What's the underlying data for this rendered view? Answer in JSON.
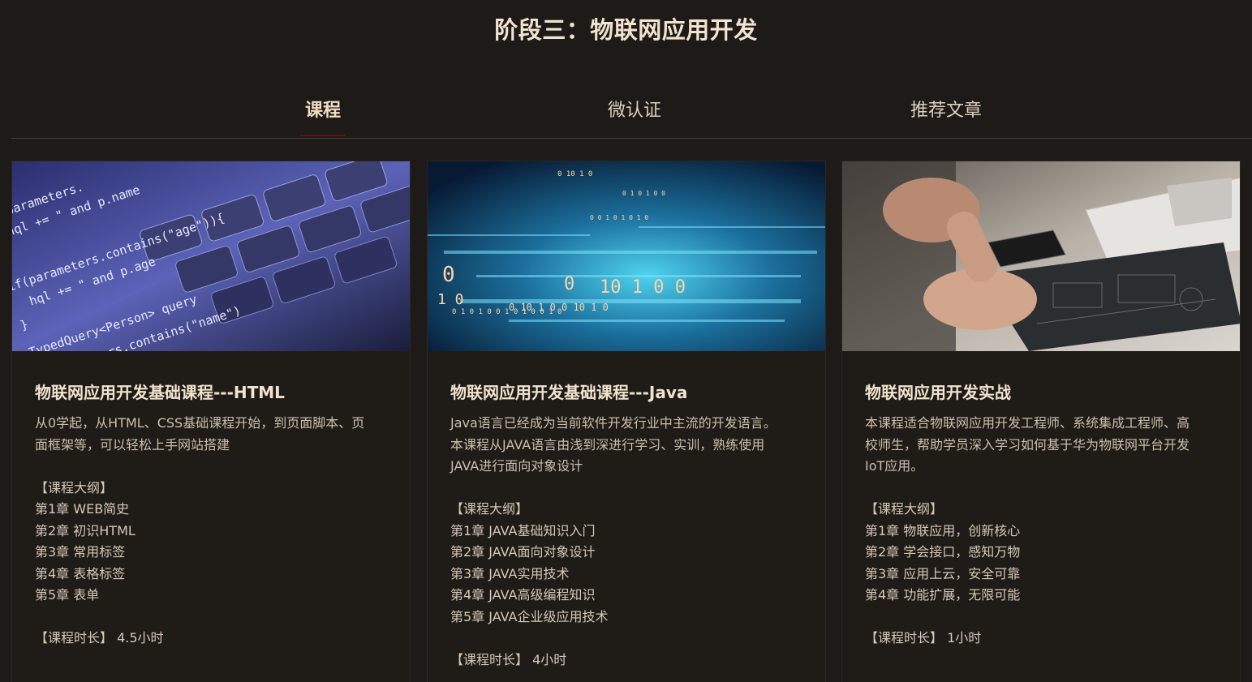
{
  "header": {
    "title": "阶段三：物联网应用开发"
  },
  "tabs": [
    {
      "label": "课程",
      "active": true
    },
    {
      "label": "微认证",
      "active": false
    },
    {
      "label": "推荐文章",
      "active": false
    }
  ],
  "colors": {
    "background": "#1d1a17",
    "accent_underline": "#5a1714",
    "title_text": "#f1e3cf"
  },
  "cards": [
    {
      "image_icon": "code-keyboard-image",
      "title": "物联网应用开发基础课程---HTML",
      "description": [
        "从0学起，从HTML、CSS基础课程开始，到页面脚本、页",
        "面框架等，可以轻松上手网站搭建"
      ],
      "outline_heading": "【课程大纲】",
      "chapters": [
        "第1章 WEB简史",
        "第2章 初识HTML",
        "第3章 常用标签",
        "第4章 表格标签",
        "第5章 表单"
      ],
      "duration": "【课程时长】 4.5小时"
    },
    {
      "image_icon": "binary-data-image",
      "title": "物联网应用开发基础课程---Java",
      "description": [
        "Java语言已经成为当前软件开发行业中主流的开发语言。",
        "本课程从JAVA语言由浅到深进行学习、实训，熟练使用",
        "JAVA进行面向对象设计"
      ],
      "outline_heading": "【课程大纲】",
      "chapters": [
        "第1章 JAVA基础知识入门",
        "第2章 JAVA面向对象设计",
        "第3章 JAVA实用技术",
        "第4章 JAVA高级编程知识",
        "第5章 JAVA企业级应用技术"
      ],
      "duration": "【课程时长】 4小时"
    },
    {
      "image_icon": "laptop-phone-desk-image",
      "title": "物联网应用开发实战",
      "description": [
        "本课程适合物联网应用开发工程师、系统集成工程师、高",
        "校师生，帮助学员深入学习如何基于华为物联网平台开发",
        "IoT应用。"
      ],
      "outline_heading": "【课程大纲】",
      "chapters": [
        "第1章 物联应用，创新核心",
        "第2章 学会接口，感知万物",
        "第3章 应用上云，安全可靠",
        "第4章 功能扩展，无限可能"
      ],
      "duration": "【课程时长】 1小时"
    }
  ]
}
